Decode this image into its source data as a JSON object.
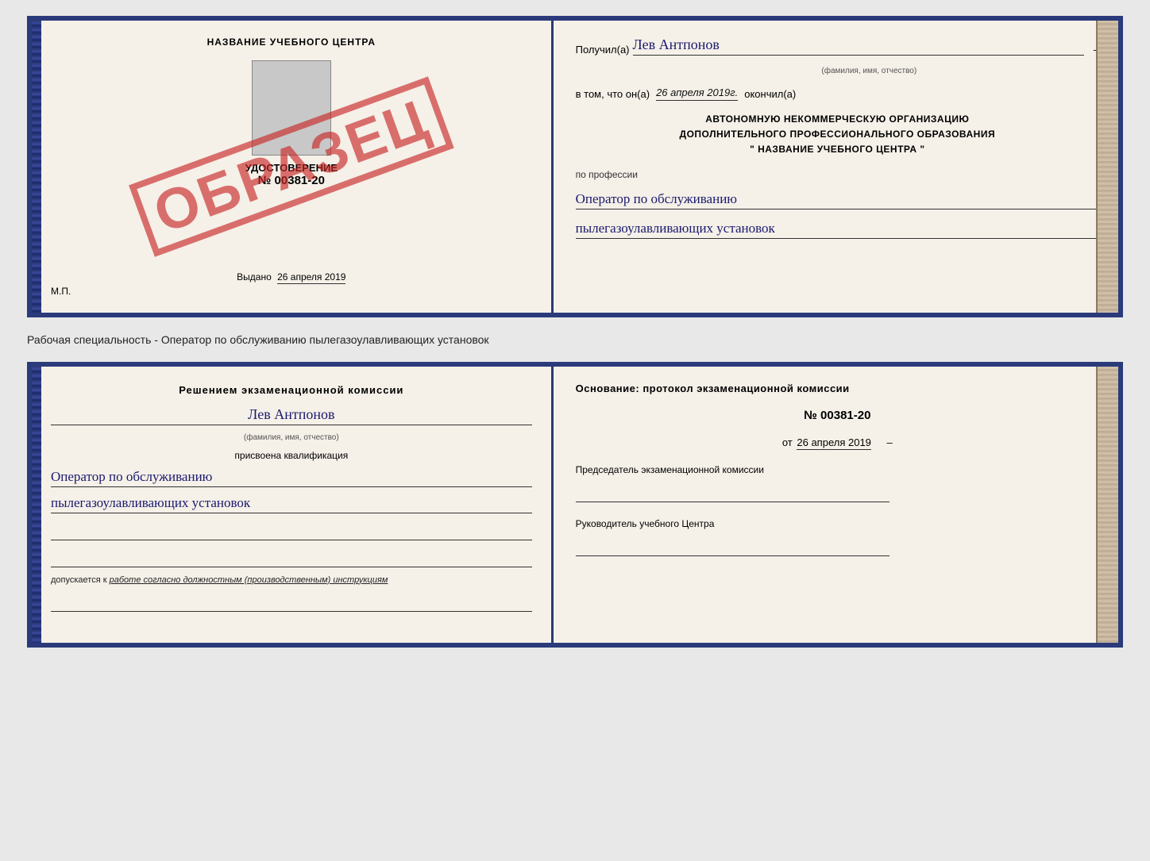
{
  "top_cert": {
    "left": {
      "header": "НАЗВАНИЕ УЧЕБНОГО ЦЕНТРА",
      "stamp": "ОБРАЗЕЦ",
      "doc_label": "УДОСТОВЕРЕНИЕ",
      "doc_number": "№ 00381-20",
      "issued_label": "Выдано",
      "issued_date": "26 апреля 2019",
      "mp_label": "М.П."
    },
    "right": {
      "recipient_label": "Получил(а)",
      "recipient_name": "Лев Антпонов",
      "fio_hint": "(фамилия, имя, отчество)",
      "date_label": "в том, что он(а)",
      "date_value": "26 апреля 2019г.",
      "date_suffix": "окончил(а)",
      "org_line1": "АВТОНОМНУЮ НЕКОММЕРЧЕСКУЮ ОРГАНИЗАЦИЮ",
      "org_line2": "ДОПОЛНИТЕЛЬНОГО ПРОФЕССИОНАЛЬНОГО ОБРАЗОВАНИЯ",
      "org_name": "\"   НАЗВАНИЕ УЧЕБНОГО ЦЕНТРА   \"",
      "profession_label": "по профессии",
      "profession_line1": "Оператор по обслуживанию",
      "profession_line2": "пылегазоулавливающих установок"
    }
  },
  "working_specialty": "Рабочая специальность - Оператор по обслуживанию пылегазоулавливающих установок",
  "bottom_cert": {
    "left": {
      "decision_label": "Решением экзаменационной комиссии",
      "name": "Лев Антпонов",
      "fio_hint": "(фамилия, имя, отчество)",
      "qualification_label": "присвоена квалификация",
      "qualification_line1": "Оператор по обслуживанию",
      "qualification_line2": "пылегазоулавливающих установок",
      "allowed_prefix": "допускается к",
      "allowed_value": "работе согласно должностным (производственным) инструкциям"
    },
    "right": {
      "basis_label": "Основание: протокол экзаменационной комиссии",
      "protocol_number": "№  00381-20",
      "protocol_date_prefix": "от",
      "protocol_date": "26 апреля 2019",
      "chairman_label": "Председатель экзаменационной комиссии",
      "director_label": "Руководитель учебного Центра"
    }
  }
}
